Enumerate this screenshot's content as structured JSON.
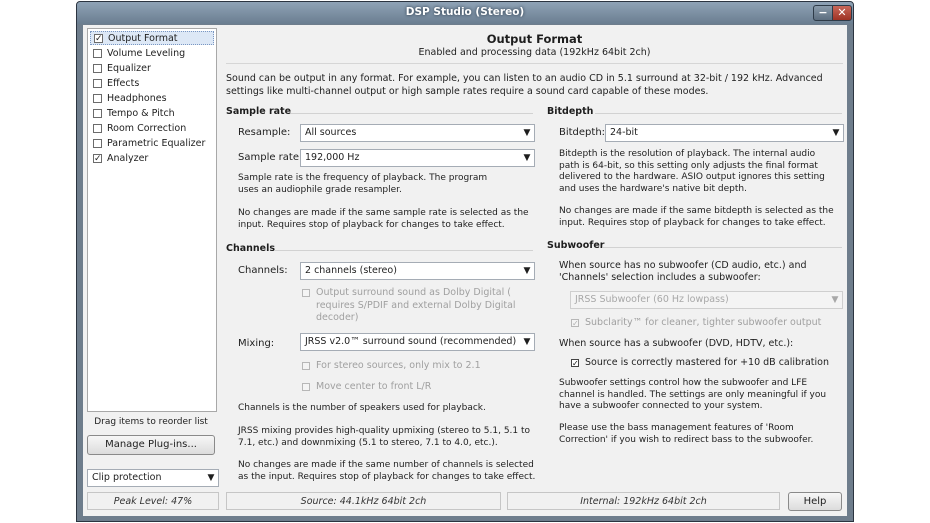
{
  "window": {
    "title": "DSP Studio (Stereo)",
    "min_glyph": "−",
    "close_glyph": "✕"
  },
  "sidebar": {
    "items": [
      {
        "label": "Output Format",
        "checked": true,
        "selected": true
      },
      {
        "label": "Volume Leveling",
        "checked": false
      },
      {
        "label": "Equalizer",
        "checked": false
      },
      {
        "label": "Effects",
        "checked": false
      },
      {
        "label": "Headphones",
        "checked": false
      },
      {
        "label": "Tempo & Pitch",
        "checked": false
      },
      {
        "label": "Room Correction",
        "checked": false
      },
      {
        "label": "Parametric Equalizer",
        "checked": false
      },
      {
        "label": "Analyzer",
        "checked": true
      }
    ],
    "check_glyph": "✓",
    "drag_hint": "Drag items to reorder list",
    "manage_button": "Manage Plug-ins...",
    "clip_select": "Clip protection",
    "peak_label": "Peak Level: 47%"
  },
  "header": {
    "title": "Output Format",
    "subtitle": "Enabled and processing data (192kHz 64bit 2ch)"
  },
  "intro": "Sound can be output in any format.  For example, you can listen to an audio CD in 5.1 surround at 32-bit / 192 kHz.  Advanced settings like multi-channel output or high sample rates require a sound card capable of these modes.",
  "sample_rate": {
    "heading": "Sample rate",
    "resample_label": "Resample:",
    "resample_value": "All sources",
    "rate_label": "Sample rate:",
    "rate_value": "192,000 Hz",
    "desc1": "Sample rate is the frequency of playback.  The program uses an audiophile grade resampler.",
    "desc2": "No changes are made if the same sample rate is selected as the input.  Requires stop of playback for changes to take effect."
  },
  "bitdepth": {
    "heading": "Bitdepth",
    "label": "Bitdepth:",
    "value": "24-bit",
    "desc1": "Bitdepth is the resolution of playback.  The internal audio path is 64-bit, so this setting only adjusts the final format delivered to the hardware.  ASIO output ignores this setting and uses the hardware's native bit depth.",
    "desc2": "No changes are made if the same bitdepth is selected as the input.  Requires stop of playback for changes to take effect."
  },
  "channels": {
    "heading": "Channels",
    "channels_label": "Channels:",
    "channels_value": "2 channels (stereo)",
    "surround_opt": "Output surround sound as Dolby Digital ( requires S/PDIF and external Dolby Digital decoder)",
    "mixing_label": "Mixing:",
    "mixing_value": "JRSS v2.0™ surround sound (recommended)",
    "stereo_opt": "For stereo sources, only mix to 2.1",
    "center_opt": "Move center to front L/R",
    "desc1": "Channels is the number of speakers used for playback.",
    "desc2": "JRSS mixing provides high-quality upmixing (stereo to 5.1, 5.1 to 7.1, etc.) and downmixing (5.1 to stereo, 7.1 to 4.0, etc.).",
    "desc3": "No changes are made if the same number of channels is selected as the input.  Requires stop of playback for changes to take effect."
  },
  "subwoofer": {
    "heading": "Subwoofer",
    "no_sub_text": "When source has no subwoofer (CD audio, etc.) and 'Channels' selection includes a subwoofer:",
    "sub_select": "JRSS Subwoofer (60 Hz lowpass)",
    "subclarity_opt": "Subclarity™ for cleaner, tighter subwoofer output",
    "has_sub_text": "When source has a subwoofer (DVD, HDTV, etc.):",
    "mastered_opt": "Source is correctly mastered for +10 dB calibration",
    "desc1": "Subwoofer settings control how the subwoofer and LFE channel is handled.  The settings are only meaningful if you have a subwoofer connected to your system.",
    "desc2": "Please use the bass management features of 'Room Correction' if you wish to redirect bass to the subwoofer."
  },
  "status": {
    "source": "Source: 44.1kHz 64bit 2ch",
    "internal": "Internal: 192kHz 64bit 2ch",
    "help_button": "Help"
  },
  "dropdown_arrow": "▼"
}
